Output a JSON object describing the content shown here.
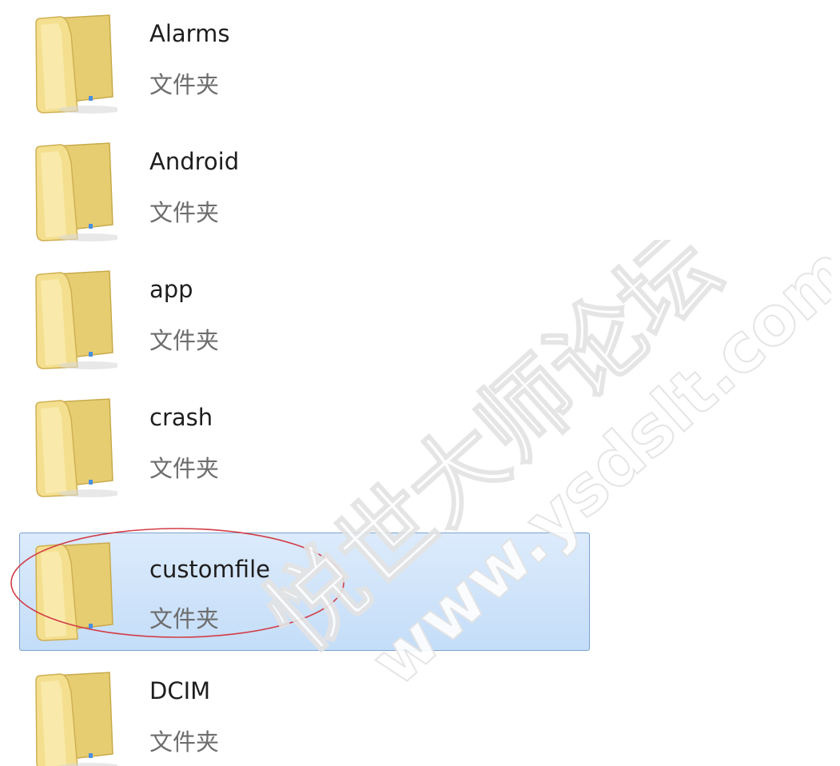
{
  "colors": {
    "selection_bg": "#cfe3fa",
    "selection_border": "#7da2ce",
    "annotation_circle": "#d23c46",
    "folder_yellow": "#f2dc8a"
  },
  "items": [
    {
      "name": "Alarms",
      "type": "文件夹",
      "icon": "folder-icon",
      "selected": false
    },
    {
      "name": "Android",
      "type": "文件夹",
      "icon": "folder-icon",
      "selected": false
    },
    {
      "name": "app",
      "type": "文件夹",
      "icon": "folder-icon",
      "selected": false
    },
    {
      "name": "crash",
      "type": "文件夹",
      "icon": "folder-icon",
      "selected": false
    },
    {
      "name": "customfile",
      "type": "文件夹",
      "icon": "folder-icon",
      "selected": true
    },
    {
      "name": "DCIM",
      "type": "文件夹",
      "icon": "folder-icon",
      "selected": false
    }
  ],
  "watermark": {
    "line1": "悦世大师论坛",
    "line2": "www.ysdslt.com"
  }
}
